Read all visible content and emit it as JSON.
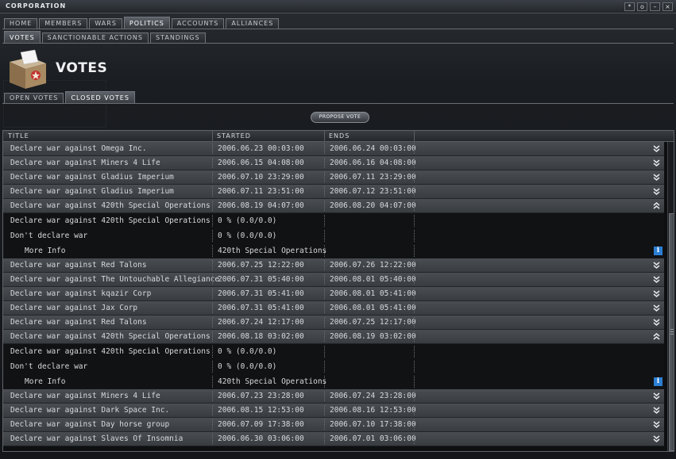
{
  "window": {
    "title": "CORPORATION",
    "buttons": [
      "*",
      "o",
      "–",
      "×"
    ]
  },
  "tabs_main": [
    "HOME",
    "MEMBERS",
    "WARS",
    "POLITICS",
    "ACCOUNTS",
    "ALLIANCES"
  ],
  "tabs_main_active": "POLITICS",
  "tabs_sub": [
    "VOTES",
    "SANCTIONABLE ACTIONS",
    "STANDINGS"
  ],
  "tabs_sub_active": "VOTES",
  "page_title": "VOTES",
  "tabs_votes": [
    "OPEN VOTES",
    "CLOSED VOTES"
  ],
  "tabs_votes_active": "CLOSED VOTES",
  "propose_button": "PROPOSE VOTE",
  "columns": [
    "TITLE",
    "STARTED",
    "ENDS"
  ],
  "rows": [
    {
      "kind": "vote",
      "title": "Declare war against Omega Inc.",
      "started": "2006.06.23  00:03:00",
      "ends": "2006.06.24  00:03:00",
      "expanded": false
    },
    {
      "kind": "vote",
      "title": "Declare war against Miners 4 Life",
      "started": "2006.06.15  04:08:00",
      "ends": "2006.06.16  04:08:00",
      "expanded": false
    },
    {
      "kind": "vote",
      "title": "Declare war against Gladius Imperium",
      "started": "2006.07.10  23:29:00",
      "ends": "2006.07.11  23:29:00",
      "expanded": false
    },
    {
      "kind": "vote",
      "title": "Declare war against Gladius Imperium",
      "started": "2006.07.11  23:51:00",
      "ends": "2006.07.12  23:51:00",
      "expanded": false
    },
    {
      "kind": "vote",
      "title": "Declare war against 420th Special Operations",
      "started": "2006.08.19  04:07:00",
      "ends": "2006.08.20  04:07:00",
      "expanded": true
    },
    {
      "kind": "opt",
      "title": "Declare war against 420th Special Operations",
      "started": "0 %  (0.0/0.0)",
      "ends": ""
    },
    {
      "kind": "opt",
      "title": "Don't declare war",
      "started": "0 %  (0.0/0.0)",
      "ends": ""
    },
    {
      "kind": "info",
      "title": "More Info",
      "started": "420th Special Operations",
      "ends": ""
    },
    {
      "kind": "vote",
      "title": "Declare war against Red Talons",
      "started": "2006.07.25  12:22:00",
      "ends": "2006.07.26  12:22:00",
      "expanded": false
    },
    {
      "kind": "vote",
      "title": "Declare war against The Untouchable Allegiance",
      "started": "2006.07.31  05:40:00",
      "ends": "2006.08.01  05:40:00",
      "expanded": false
    },
    {
      "kind": "vote",
      "title": "Declare war against kqazir Corp",
      "started": "2006.07.31  05:41:00",
      "ends": "2006.08.01  05:41:00",
      "expanded": false
    },
    {
      "kind": "vote",
      "title": "Declare war against Jax Corp",
      "started": "2006.07.31  05:41:00",
      "ends": "2006.08.01  05:41:00",
      "expanded": false
    },
    {
      "kind": "vote",
      "title": "Declare war against Red Talons",
      "started": "2006.07.24  12:17:00",
      "ends": "2006.07.25  12:17:00",
      "expanded": false
    },
    {
      "kind": "vote",
      "title": "Declare war against 420th Special Operations",
      "started": "2006.08.18  03:02:00",
      "ends": "2006.08.19  03:02:00",
      "expanded": true
    },
    {
      "kind": "opt",
      "title": "Declare war against 420th Special Operations",
      "started": "0 %  (0.0/0.0)",
      "ends": ""
    },
    {
      "kind": "opt",
      "title": "Don't declare war",
      "started": "0 %  (0.0/0.0)",
      "ends": ""
    },
    {
      "kind": "info",
      "title": "More Info",
      "started": "420th Special Operations",
      "ends": ""
    },
    {
      "kind": "vote",
      "title": "Declare war against Miners 4 Life",
      "started": "2006.07.23  23:28:00",
      "ends": "2006.07.24  23:28:00",
      "expanded": false
    },
    {
      "kind": "vote",
      "title": "Declare war against Dark Space Inc.",
      "started": "2006.08.15  12:53:00",
      "ends": "2006.08.16  12:53:00",
      "expanded": false
    },
    {
      "kind": "vote",
      "title": "Declare war against Day horse group",
      "started": "2006.07.09  17:38:00",
      "ends": "2006.07.10  17:38:00",
      "expanded": false
    },
    {
      "kind": "vote",
      "title": "Declare war against Slaves Of Insomnia",
      "started": "2006.06.30  03:06:00",
      "ends": "2006.07.01  03:06:00",
      "expanded": false
    }
  ],
  "colors": {
    "accent_info": "#2b7fd4",
    "row_bg": "#44484d",
    "panel_bg": "#111214"
  }
}
